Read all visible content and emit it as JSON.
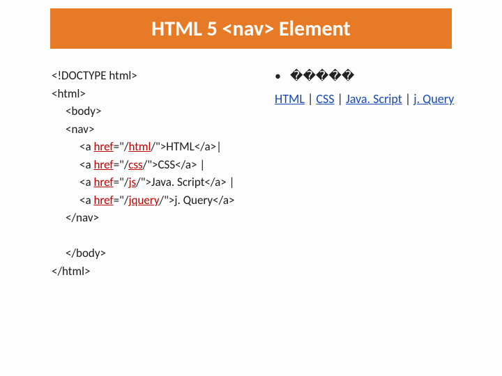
{
  "title": "HTML 5 <nav> Element",
  "code": {
    "l1": "<!DOCTYPE html>",
    "l2": "<html>",
    "l3": "<body>",
    "l4": "<nav>",
    "l5a": "<a ",
    "l5b": "href",
    "l5c": "=\"/",
    "l5d": "html",
    "l5e": "/\">HTML</a>|",
    "l6a": "<a ",
    "l6b": "href",
    "l6c": "=\"/",
    "l6d": "css",
    "l6e": "/\">CSS</a> |",
    "l7a": "<a ",
    "l7b": "href",
    "l7c": "=\"/",
    "l7d": "js",
    "l7e": "/\">Java. Script</a> |",
    "l8a": "<a ",
    "l8b": "href",
    "l8c": "=\"/",
    "l8d": "jquery",
    "l8e": "/\">j. Query</a>",
    "l9": "</nav>",
    "l10": "</body>",
    "l11": "</html>"
  },
  "bullet": {
    "dot": "•",
    "text": "�����"
  },
  "links": {
    "a1": "HTML",
    "a2": "CSS",
    "a3": "Java. Script",
    "a4": "j. Query",
    "sep": " | "
  }
}
